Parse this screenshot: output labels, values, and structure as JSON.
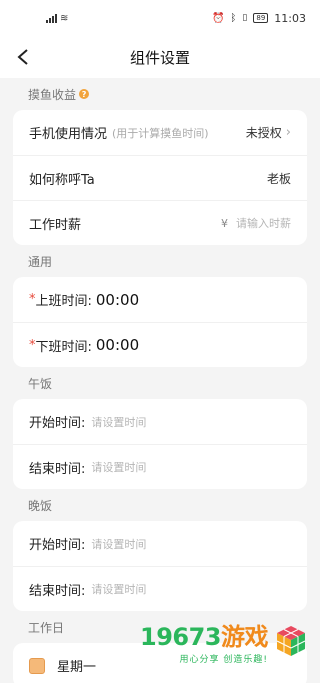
{
  "status": {
    "time": "11:03",
    "battery": "89"
  },
  "nav": {
    "title": "组件设置"
  },
  "fishing": {
    "label": "摸鱼收益",
    "phone_usage_label": "手机使用情况",
    "phone_usage_hint": "(用于计算摸鱼时间)",
    "phone_usage_value": "未授权",
    "call_label": "如何称呼Ta",
    "call_value": "老板",
    "salary_label": "工作时薪",
    "salary_currency": "¥",
    "salary_placeholder": "请输入时薪"
  },
  "general": {
    "label": "通用",
    "start_label": "上班时间:",
    "start_value": "00:00",
    "end_label": "下班时间:",
    "end_value": "00:00",
    "required_mark": "*"
  },
  "lunch": {
    "label": "午饭",
    "start_label": "开始时间:",
    "start_placeholder": "请设置时间",
    "end_label": "结束时间:",
    "end_placeholder": "请设置时间"
  },
  "dinner": {
    "label": "晚饭",
    "start_label": "开始时间:",
    "start_placeholder": "请设置时间",
    "end_label": "结束时间:",
    "end_placeholder": "请设置时间"
  },
  "workdays": {
    "label": "工作日",
    "items": [
      {
        "label": "星期一",
        "checked": true
      }
    ]
  },
  "watermark": {
    "digits": "19673",
    "cn": "游戏",
    "slogan": "用心分享 创造乐趣!"
  },
  "colors": {
    "accent": "#f2a33a",
    "required": "#e64a3c",
    "watermark_green": "#2bb65b"
  }
}
